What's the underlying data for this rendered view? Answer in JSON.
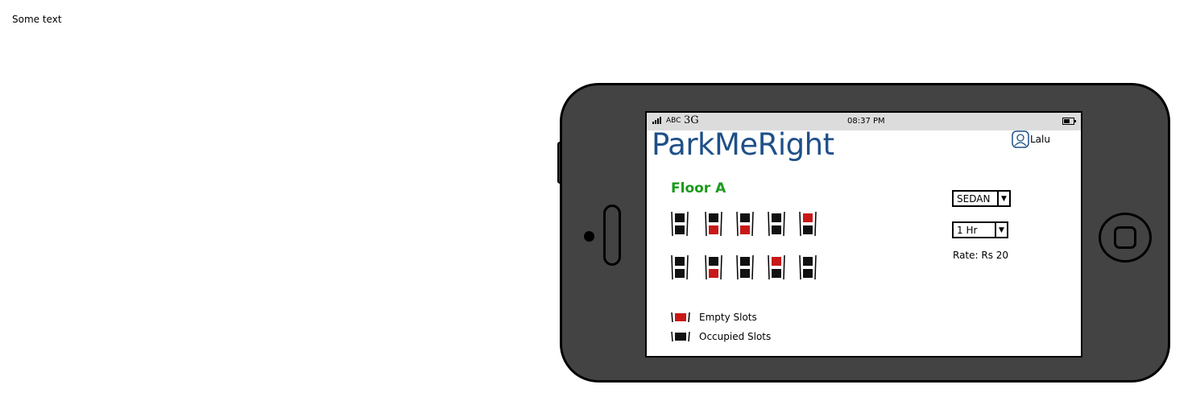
{
  "page": {
    "note": "Some text"
  },
  "status_bar": {
    "carrier": "ABC",
    "network": "3G",
    "time": "08:37 PM"
  },
  "app": {
    "title": "ParkMeRight",
    "user_name": "Lalu"
  },
  "floor": {
    "title": "Floor A",
    "rows": [
      [
        "occupied",
        "mixed",
        "mixed",
        "occupied",
        "mixed-top"
      ],
      [
        "occupied",
        "mixed",
        "occupied",
        "mixed-top",
        "occupied"
      ]
    ]
  },
  "controls": {
    "vehicle_type": "SEDAN",
    "duration": "1 Hr",
    "rate_text": "Rate: Rs 20"
  },
  "legend": {
    "empty_label": "Empty Slots",
    "occupied_label": "Occupied Slots"
  },
  "colors": {
    "empty": "#c81818",
    "occupied": "#111111",
    "title": "#1f5088",
    "floor": "#1b9a1b"
  },
  "icons": {
    "user": "user-icon",
    "dropdown": "chevron-down-icon",
    "battery": "battery-icon",
    "signal": "signal-icon"
  }
}
